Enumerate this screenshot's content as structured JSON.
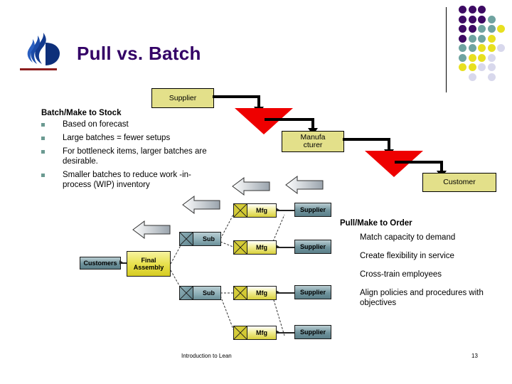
{
  "slide": {
    "title": "Pull vs. Batch",
    "title_color": "#330066",
    "logo_name": "georgia-state-flame-logo"
  },
  "decor": {
    "dot_colors": {
      "purple": "#3d0a63",
      "teal": "#6fa3a0",
      "yellow": "#e8e020",
      "lavender": "#d8d8ec"
    },
    "grid": [
      [
        "purple",
        "purple",
        "purple",
        "",
        ""
      ],
      [
        "purple",
        "purple",
        "purple",
        "teal",
        ""
      ],
      [
        "purple",
        "purple",
        "teal",
        "teal",
        "yellow"
      ],
      [
        "purple",
        "teal",
        "teal",
        "yellow",
        ""
      ],
      [
        "teal",
        "teal",
        "yellow",
        "yellow",
        "lavender"
      ],
      [
        "teal",
        "yellow",
        "yellow",
        "lavender",
        ""
      ],
      [
        "yellow",
        "yellow",
        "lavender",
        "lavender",
        ""
      ],
      [
        "",
        "lavender",
        "",
        "lavender",
        ""
      ]
    ]
  },
  "left_block": {
    "heading": "Batch/Make to Stock",
    "bullets": [
      "Based on forecast",
      "Large batches = fewer setups",
      "For bottleneck items, larger batches are desirable.",
      "Smaller batches to reduce work -in-process (WIP) inventory"
    ],
    "bullet_color": "#6b9a91"
  },
  "right_block": {
    "heading": "Pull/Make to Order",
    "items": [
      "Match capacity to demand",
      "Create flexibility in service",
      "Cross-train employees",
      "Align policies and procedures with objectives"
    ]
  },
  "batch_flow": {
    "box_fill": "#e3e08a",
    "triangle_color": "#ee0000",
    "nodes": [
      {
        "label": "Supplier"
      },
      {
        "label": "Manufa cturer"
      },
      {
        "label": "Customer"
      }
    ],
    "node_supplier": "Supplier",
    "node_manufacturer_line1": "Manufa",
    "node_manufacturer_line2": "cturer",
    "node_customer": "Customer"
  },
  "pull_diagram": {
    "customers": "Customers",
    "final_assembly_line1": "Final",
    "final_assembly_line2": "Assembly",
    "sub_label": "Sub",
    "mfg_label": "Mfg",
    "supplier_label": "Supplier",
    "subs": [
      {
        "label": "Sub"
      },
      {
        "label": "Sub"
      }
    ],
    "mfgs": [
      {
        "label": "Mfg",
        "supplier": "Supplier"
      },
      {
        "label": "Mfg",
        "supplier": "Supplier"
      },
      {
        "label": "Mfg",
        "supplier": "Supplier"
      },
      {
        "label": "Mfg",
        "supplier": "Supplier"
      }
    ]
  },
  "footer": {
    "left": "Introduction to Lean",
    "page": "13"
  }
}
